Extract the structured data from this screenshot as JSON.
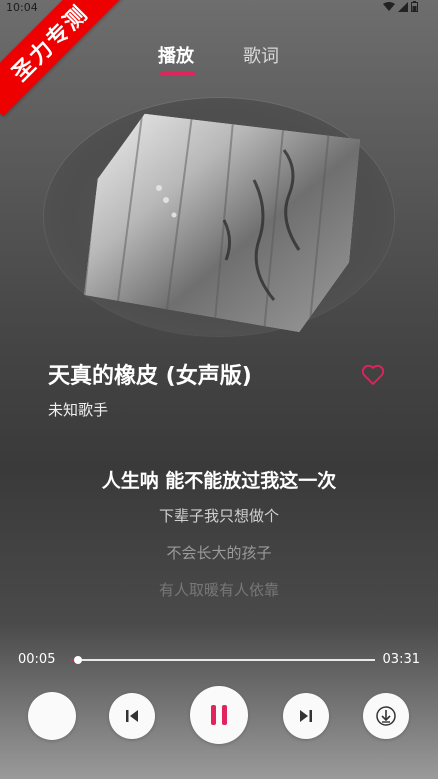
{
  "status": {
    "time": "10:04"
  },
  "ribbon": {
    "text": "圣力专测"
  },
  "tabs": {
    "play": "播放",
    "lyrics": "歌词"
  },
  "song": {
    "title": "天真的橡皮 (女声版)",
    "artist": "未知歌手"
  },
  "lyrics": {
    "current": "人生呐 能不能放过我这一次",
    "next1": "下辈子我只想做个",
    "next2": "不会长大的孩子",
    "next3": "有人取暖有人依靠"
  },
  "progress": {
    "current_time": "00:05",
    "total_time": "03:31",
    "fraction": 0.024
  },
  "colors": {
    "accent": "#e0245e"
  },
  "icons": {
    "mode": "mode-icon",
    "prev": "skip-previous-icon",
    "play": "pause-icon",
    "next": "skip-next-icon",
    "download": "download-icon",
    "favorite": "heart-outline-icon"
  }
}
